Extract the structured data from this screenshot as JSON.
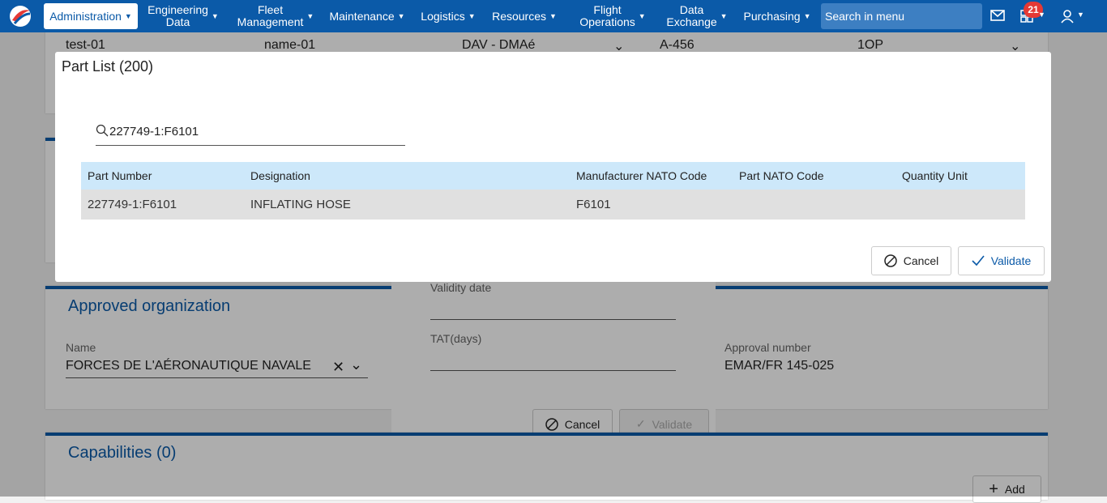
{
  "nav": {
    "items": [
      {
        "label": "Administration"
      },
      {
        "label": "Engineering\nData"
      },
      {
        "label": "Fleet\nManagement"
      },
      {
        "label": "Maintenance"
      },
      {
        "label": "Logistics"
      },
      {
        "label": "Resources"
      },
      {
        "label": "Flight\nOperations"
      },
      {
        "label": "Data\nExchange"
      },
      {
        "label": "Purchasing"
      }
    ],
    "search_placeholder": "Search in menu",
    "notification_count": "21"
  },
  "background": {
    "row": {
      "c1": "test-01",
      "c2": "name-01",
      "c3": "DAV - DMAé",
      "c4": "A-456",
      "c5": "1OP"
    },
    "approved_org": {
      "title": "Approved organization",
      "name_label": "Name",
      "name_value": "FORCES DE L'AÉRONAUTIQUE NAVALE",
      "approval_label": "Approval number",
      "approval_value": "EMAR/FR 145-025"
    },
    "form": {
      "validity_label": "Validity date",
      "tat_label": "TAT(days)",
      "cancel_label": "Cancel",
      "validate_label": "Validate"
    },
    "capabilities": {
      "title": "Capabilities (0)",
      "add_label": "Add"
    }
  },
  "modal": {
    "title": "Part List (200)",
    "search_value": "227749-1:F6101",
    "columns": [
      "Part Number",
      "Designation",
      "Manufacturer NATO Code",
      "Part NATO Code",
      "Quantity Unit"
    ],
    "rows": [
      [
        "227749-1:F6101",
        "INFLATING HOSE",
        "F6101",
        "",
        ""
      ]
    ],
    "cancel_label": "Cancel",
    "validate_label": "Validate"
  },
  "colors": {
    "nav": "#0b5aa8",
    "header_row": "#cde8fa",
    "badge": "#e53935"
  }
}
